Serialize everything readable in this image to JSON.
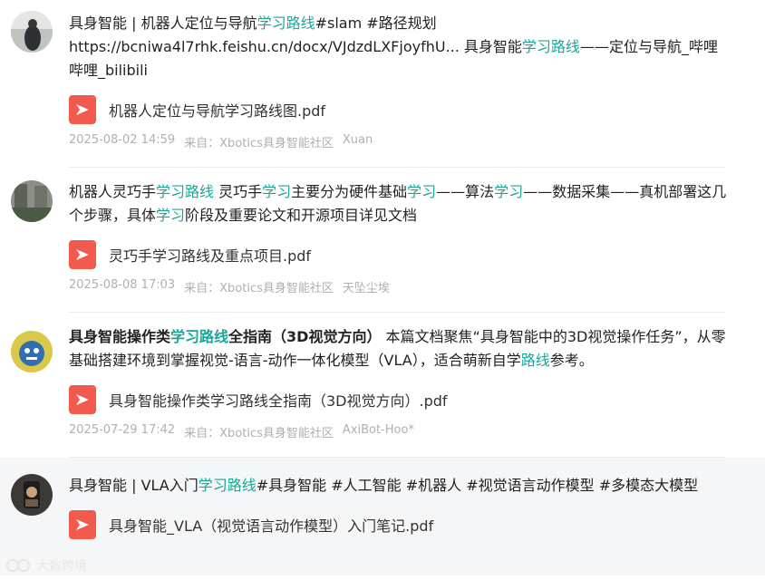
{
  "posts": [
    {
      "segments": [
        {
          "t": "具身智能 | 机器人定位与导航",
          "s": "n"
        },
        {
          "t": "学习路线",
          "s": "h"
        },
        {
          "t": "#slam  #路径规划",
          "s": "n"
        },
        {
          "t": "https://bcniwa4l7rhk.feishu.cn/docx/VJdzdLXFjoyfhU...  具身智能",
          "s": "n"
        },
        {
          "t": "学习路线",
          "s": "h"
        },
        {
          "t": "——定位与导航_哔哩哔哩_bilibili",
          "s": "n"
        }
      ],
      "file": "机器人定位与导航学习路线图.pdf",
      "time": "2025-08-02 14:59",
      "source": "来自：Xbotics具身智能社区",
      "author": "Xuan"
    },
    {
      "segments": [
        {
          "t": "机器人灵巧手",
          "s": "n"
        },
        {
          "t": "学习路线",
          "s": "h"
        },
        {
          "t": " 灵巧手",
          "s": "n"
        },
        {
          "t": "学习",
          "s": "h"
        },
        {
          "t": "主要分为硬件基础",
          "s": "n"
        },
        {
          "t": "学习",
          "s": "h"
        },
        {
          "t": "——算法",
          "s": "n"
        },
        {
          "t": "学习",
          "s": "h"
        },
        {
          "t": "——数据采集——真机部署这几个步骤，具体",
          "s": "n"
        },
        {
          "t": "学习",
          "s": "h"
        },
        {
          "t": "阶段及重要论文和开源项目详见文档",
          "s": "n"
        }
      ],
      "file": "灵巧手学习路线及重点项目.pdf",
      "time": "2025-08-08 17:03",
      "source": "来自：Xbotics具身智能社区",
      "author": "天坠尘埃"
    },
    {
      "segments": [
        {
          "t": "具身智能操作类",
          "s": "b"
        },
        {
          "t": "学习路线",
          "s": "bh"
        },
        {
          "t": "全指南（3D视觉方向）",
          "s": "b"
        },
        {
          "t": "  本篇文档聚焦“具身智能中的3D视觉操作任务”，从零基础搭建环境到掌握视觉-语言-动作一体化模型（VLA），适合萌新自学",
          "s": "n"
        },
        {
          "t": "路线",
          "s": "h"
        },
        {
          "t": "参考。",
          "s": "n"
        }
      ],
      "file": "具身智能操作类学习路线全指南（3D视觉方向）.pdf",
      "time": "2025-07-29 17:42",
      "source": "来自：Xbotics具身智能社区",
      "author": "AxiBot-Hoo*"
    },
    {
      "segments": [
        {
          "t": "具身智能 | VLA入门",
          "s": "n"
        },
        {
          "t": "学习路线",
          "s": "h"
        },
        {
          "t": "#具身智能  #人工智能  #机器人  #视觉语言动作模型  #多模态大模型",
          "s": "n"
        }
      ],
      "file": "具身智能_VLA（视觉语言动作模型）入门笔记.pdf",
      "time": "",
      "source": "",
      "author": ""
    }
  ],
  "watermark": "大数跨境",
  "colors": {
    "highlight": "#1aa79a",
    "pdf": "#f25a4e",
    "meta": "#b0b0b0"
  }
}
